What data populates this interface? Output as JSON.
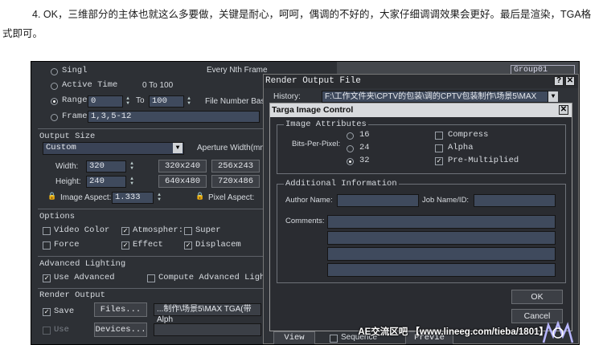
{
  "article": {
    "line1": "4. OK，三维部分的主体也就这么多要做，关键是耐心，呵呵，偶调的不好的，大家仔细调调效果会更好。最后是渲染，TGA格",
    "line2": "式即可。"
  },
  "left": {
    "single": "Singl",
    "every_nth": "Every Nth Frame",
    "active_time": "Active Time",
    "active_range": "0 To 100",
    "range": "Range",
    "range_from": "0",
    "to": "To",
    "range_to": "100",
    "file_number_base": "File Number Base",
    "frames": "Frame",
    "frames_value": "1,3,5-12",
    "output_size": "Output Size",
    "preset": "Custom",
    "aperture": "Aperture Width(mm",
    "width_label": "Width:",
    "width_value": "320",
    "height_label": "Height:",
    "height_value": "240",
    "res1": "320x240",
    "res2": "256x243",
    "res3": "640x480",
    "res4": "720x486",
    "image_aspect": "Image Aspect:",
    "image_aspect_value": "1.333",
    "pixel_aspect": "Pixel Aspect:",
    "options": "Options",
    "video_color": "Video Color",
    "atmospheric": "Atmospher:",
    "super": "Super",
    "force": "Force",
    "effects": "Effect",
    "displacement": "Displacem",
    "advanced_lighting": "Advanced Lighting",
    "use_advanced": "Use Advanced",
    "compute_advanced": "Compute Advanced Ligh",
    "render_output": "Render Output",
    "save": "Save",
    "files_btn": "Files...",
    "file_path": "...制作\\场景5\\MAX TGA(带Alph",
    "use": "Use",
    "devices_btn": "Devices...",
    "group_label": "Group01"
  },
  "rof": {
    "title": "Render Output File",
    "history": "History:",
    "history_value": "F:\\工作文件夹\\CPTV的包装\\调的CPTV包装制作\\场景5\\MAX",
    "help_btn": "?",
    "close_btn": "✕",
    "sequence": "Sequence",
    "preview": "Previe",
    "view": "View"
  },
  "tga": {
    "title": "Targa Image Control",
    "close_btn": "✕",
    "image_attributes": "Image Attributes",
    "bits_per_pixel": "Bits-Per-Pixel:",
    "bpp16": "16",
    "bpp24": "24",
    "bpp32": "32",
    "compress": "Compress",
    "alpha": "Alpha",
    "premultiplied": "Pre-Multiplied",
    "additional_info": "Additional Information",
    "author_name": "Author Name:",
    "job_name": "Job Name/ID:",
    "comments": "Comments:",
    "ok": "OK",
    "cancel": "Cancel"
  },
  "watermark": {
    "text": "AE交流区吧 【www.lineeg.com/tieba/1801】"
  }
}
